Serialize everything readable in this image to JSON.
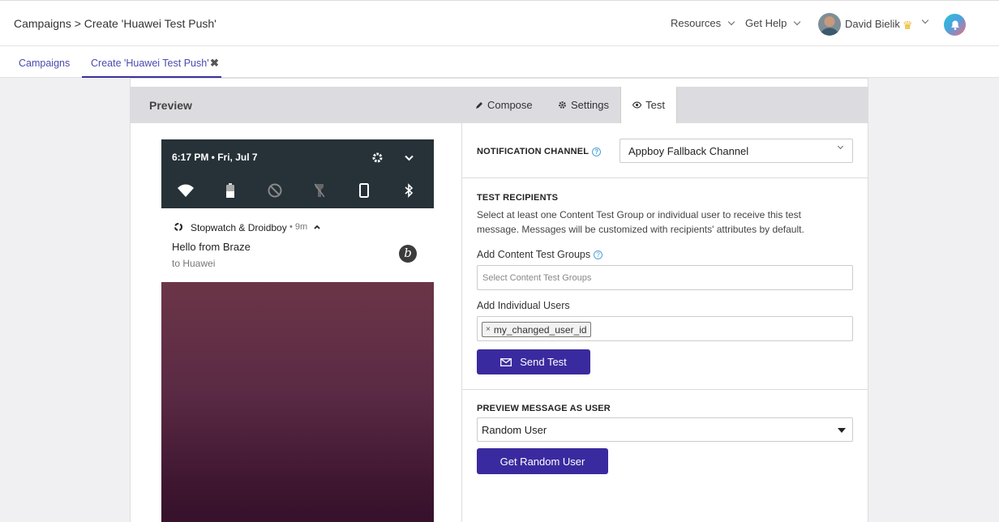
{
  "header": {
    "breadcrumb": "Campaigns > Create 'Huawei Test Push'",
    "resources_label": "Resources",
    "get_help_label": "Get Help",
    "user_name": "David Bielik"
  },
  "tabs": [
    {
      "label": "Campaigns"
    },
    {
      "label": "Create 'Huawei Test Push'"
    }
  ],
  "panel": {
    "title": "Preview",
    "tabs": [
      {
        "label": "Compose",
        "icon": "pencil-icon"
      },
      {
        "label": "Settings",
        "icon": "gear-icon"
      },
      {
        "label": "Test",
        "icon": "eye-icon"
      }
    ],
    "active_tab": "Test"
  },
  "phone": {
    "status_time": "6:17 PM • Fri, Jul 7",
    "app_name": "Stopwatch & Droidboy",
    "notif_time": "• 9m",
    "title": "Hello from Braze",
    "subtitle": "to Huawei"
  },
  "test": {
    "notification_channel_label": "NOTIFICATION CHANNEL",
    "notification_channel_value": "Appboy Fallback Channel",
    "recipients_label": "TEST RECIPIENTS",
    "recipients_desc": "Select at least one Content Test Group or individual user to receive this test message. Messages will be customized with recipients' attributes by default.",
    "content_groups_label": "Add Content Test Groups",
    "content_groups_placeholder": "Select Content Test Groups",
    "individual_users_label": "Add Individual Users",
    "user_token": "my_changed_user_id",
    "send_button": "Send Test",
    "preview_as_label": "PREVIEW MESSAGE AS USER",
    "preview_as_value": "Random User",
    "random_user_button": "Get Random User"
  },
  "colors": {
    "accent": "#3a2a9f",
    "link": "#4a4ab0",
    "phone_bar": "#263238"
  }
}
